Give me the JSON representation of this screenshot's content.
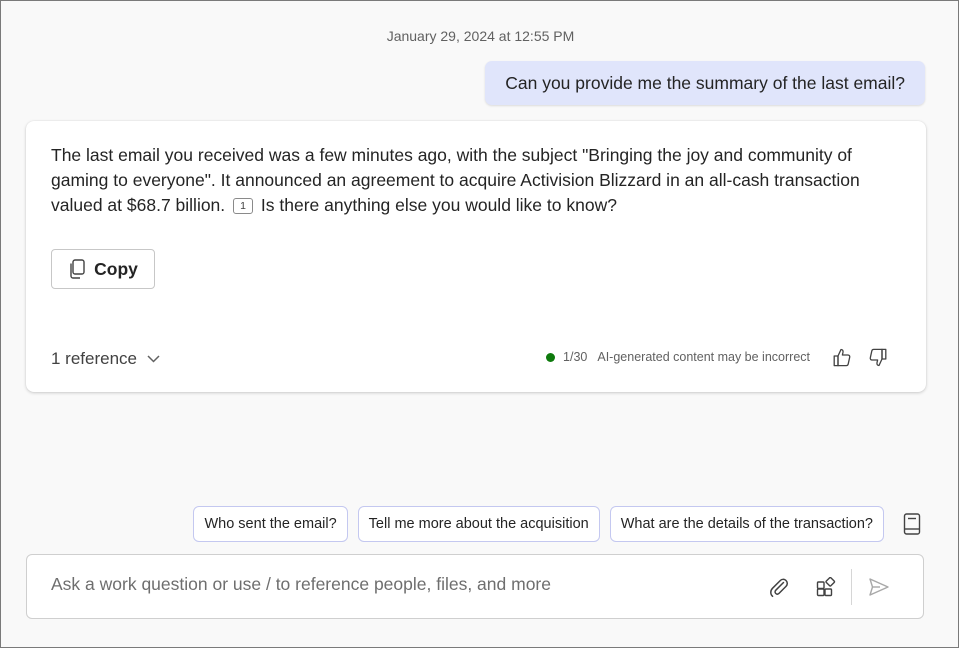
{
  "conversation": {
    "timestamp": "January 29, 2024 at 12:55 PM",
    "user_message": "Can you provide me the summary of the last email?",
    "response": {
      "text_before_citation": "The last email you received was a few minutes ago, with the subject \"Bringing the joy and community of gaming to everyone\". It announced an agreement to acquire Activision Blizzard in an all-cash transaction valued at $68.7 billion.",
      "citation_number": "1",
      "text_after_citation": "Is there anything else you would like to know?",
      "copy_label": "Copy",
      "references_label": "1 reference",
      "response_count": "1/30",
      "disclaimer": "AI-generated content may be incorrect",
      "status_color": "#0e7a0d"
    }
  },
  "suggestions": [
    "Who sent the email?",
    "Tell me more about the acquisition",
    "What are the details of the transaction?"
  ],
  "composer": {
    "placeholder": "Ask a work question or use / to reference people, files, and more"
  },
  "icons": {
    "copy": "copy-icon",
    "expand": "chevron-down-icon",
    "like": "thumbs-up-icon",
    "dislike": "thumbs-down-icon",
    "notebook": "notebook-icon",
    "attach": "paperclip-icon",
    "apps": "apps-icon",
    "send": "send-icon"
  }
}
